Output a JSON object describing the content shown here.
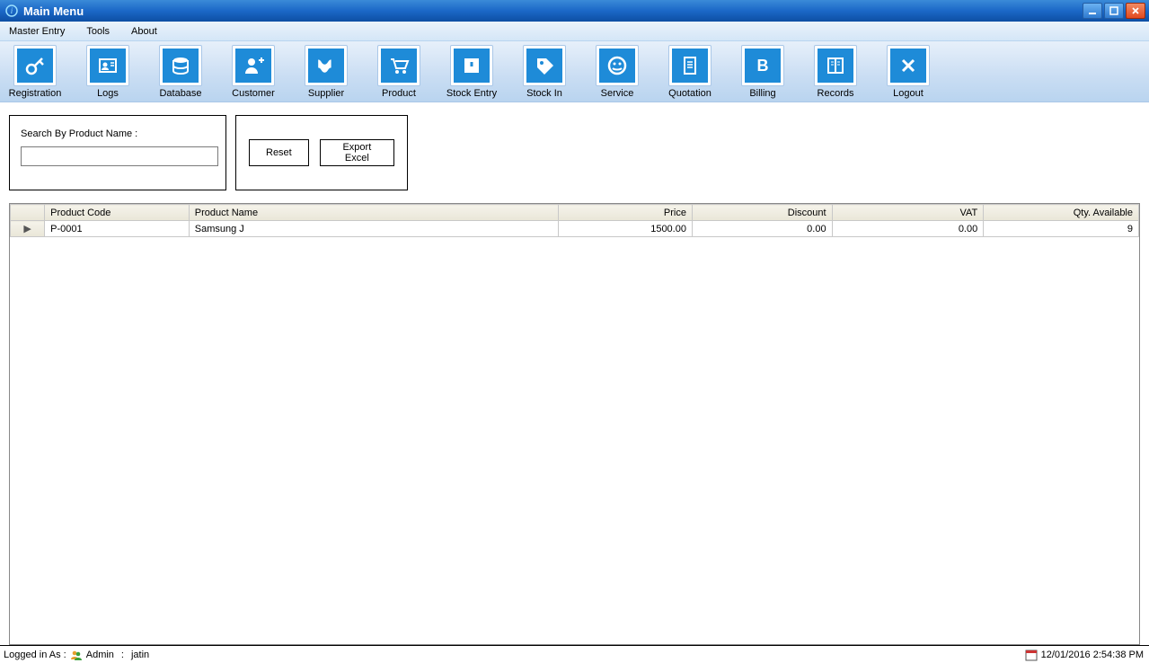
{
  "title": "Main Menu",
  "menu": {
    "items": [
      "Master Entry",
      "Tools",
      "About"
    ]
  },
  "toolbar": {
    "items": [
      {
        "label": "Registration",
        "icon": "key-icon"
      },
      {
        "label": "Logs",
        "icon": "id-card-icon"
      },
      {
        "label": "Database",
        "icon": "database-icon"
      },
      {
        "label": "Customer",
        "icon": "user-plus-icon"
      },
      {
        "label": "Supplier",
        "icon": "supplier-icon"
      },
      {
        "label": "Product",
        "icon": "cart-icon"
      },
      {
        "label": "Stock Entry",
        "icon": "box-icon"
      },
      {
        "label": "Stock In",
        "icon": "tag-icon"
      },
      {
        "label": "Service",
        "icon": "smile-icon"
      },
      {
        "label": "Quotation",
        "icon": "document-icon"
      },
      {
        "label": "Billing",
        "icon": "billing-icon"
      },
      {
        "label": "Records",
        "icon": "book-icon"
      },
      {
        "label": "Logout",
        "icon": "close-x-icon"
      }
    ]
  },
  "search": {
    "label": "Search By Product Name :",
    "value": ""
  },
  "buttons": {
    "reset": "Reset",
    "export": "Export Excel"
  },
  "grid": {
    "columns": [
      "Product Code",
      "Product Name",
      "Price",
      "Discount",
      "VAT",
      "Qty. Available"
    ],
    "rows": [
      {
        "code": "P-0001",
        "name": "Samsung J",
        "price": "1500.00",
        "discount": "0.00",
        "vat": "0.00",
        "qty": "9"
      }
    ]
  },
  "status": {
    "logged_label": "Logged in As :",
    "role": "Admin",
    "sep": ":",
    "user": "jatin",
    "datetime": "12/01/2016 2:54:38 PM"
  }
}
